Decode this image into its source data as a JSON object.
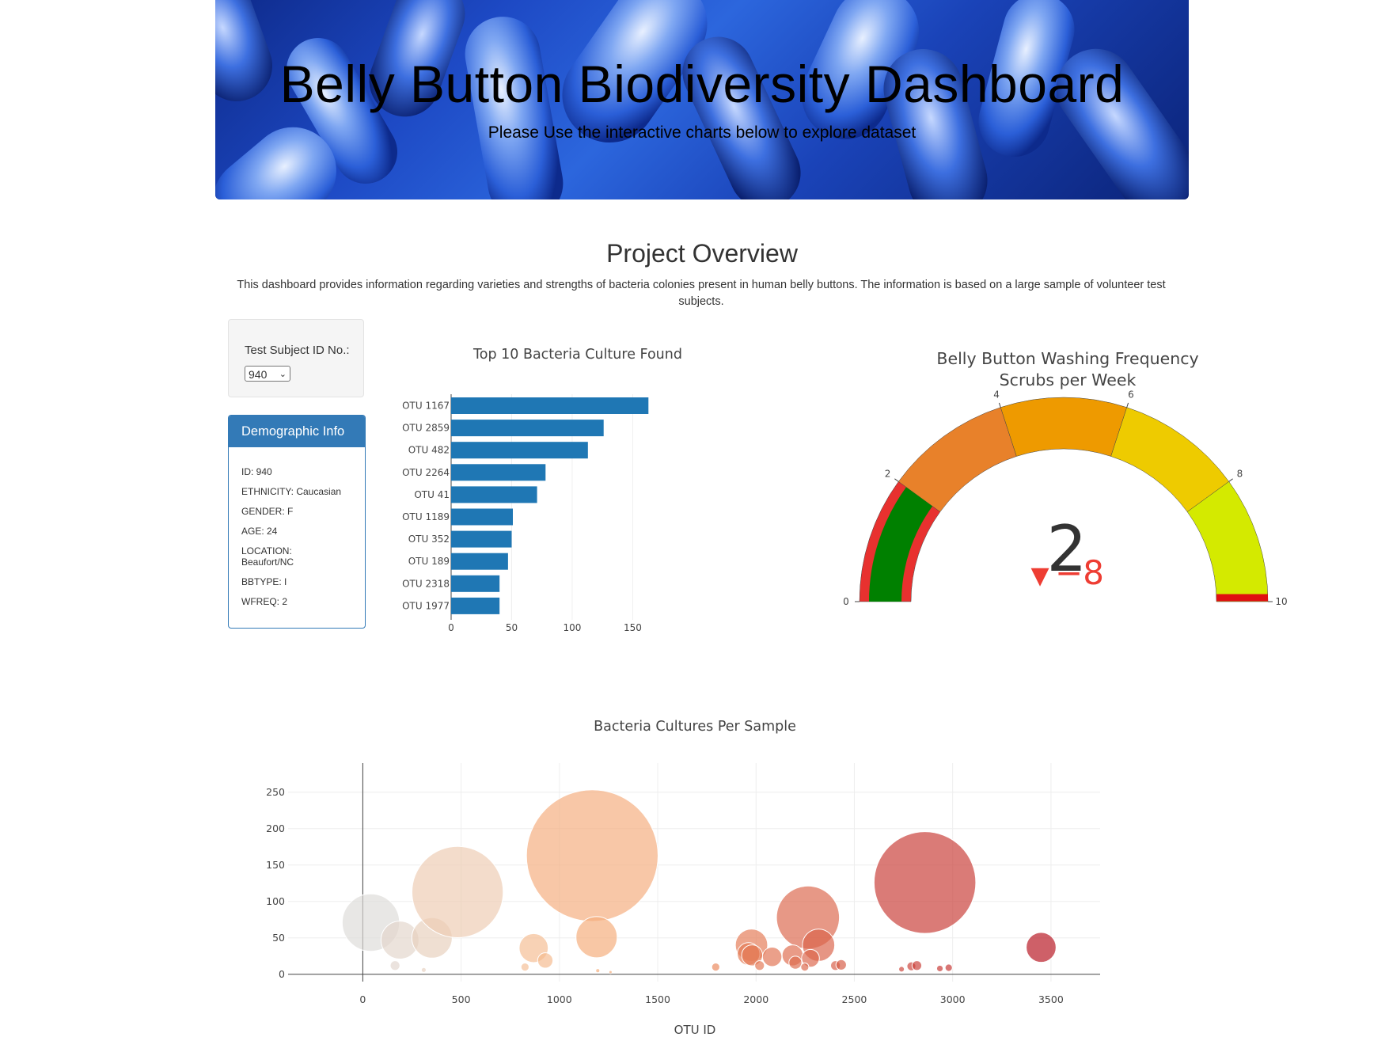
{
  "header": {
    "title": "Belly Button Biodiversity Dashboard",
    "subtitle": "Please Use the interactive charts below to explore dataset"
  },
  "overview": {
    "title": "Project Overview",
    "text": "This dashboard provides information regarding varieties and strengths of bacteria colonies present in human belly buttons. The information is based on a large sample of volunteer test subjects."
  },
  "selector": {
    "label": "Test Subject ID No.:",
    "value": "940"
  },
  "demographic": {
    "title": "Demographic Info",
    "items": [
      "ID: 940",
      "ETHNICITY: Caucasian",
      "GENDER: F",
      "AGE: 24",
      "LOCATION:\nBeaufort/NC",
      "BBTYPE: I",
      "WFREQ: 2"
    ]
  },
  "colors": {
    "bar": "#1f77b4",
    "panel": "#337ab7",
    "gauge_green": "#008000",
    "gauge_red": "#e8312f",
    "delta_red": "#ee3d33"
  },
  "chart_data": [
    {
      "type": "bar",
      "orientation": "horizontal",
      "title": "Top 10 Bacteria Culture Found",
      "categories": [
        "OTU 1167",
        "OTU 2859",
        "OTU 482",
        "OTU 2264",
        "OTU 41",
        "OTU 1189",
        "OTU 352",
        "OTU 189",
        "OTU 2318",
        "OTU 1977"
      ],
      "values": [
        163,
        126,
        113,
        78,
        71,
        51,
        50,
        47,
        40,
        40
      ],
      "xticks": [
        0,
        50,
        100,
        150
      ],
      "xlim": [
        0,
        170
      ]
    },
    {
      "type": "gauge",
      "title": "Belly Button Washing Frequency",
      "subtitle": "Scrubs per Week",
      "value": 2,
      "delta": "−8",
      "range": [
        0,
        10
      ],
      "ticks": [
        0,
        2,
        4,
        6,
        8,
        10
      ],
      "steps": [
        {
          "range": [
            0,
            2
          ],
          "color": "#e8312f"
        },
        {
          "range": [
            2,
            4
          ],
          "color": "#e8812a"
        },
        {
          "range": [
            4,
            6
          ],
          "color": "#ee9a00"
        },
        {
          "range": [
            6,
            8
          ],
          "color": "#eecb00"
        },
        {
          "range": [
            8,
            10
          ],
          "color": "#d4ea00"
        }
      ],
      "bar_color": "#008000",
      "threshold": 10,
      "threshold_color": "#e01010"
    },
    {
      "type": "scatter",
      "mode": "bubble",
      "title": "Bacteria Cultures Per Sample",
      "xlabel": "OTU ID",
      "ylabel": "",
      "xlim": [
        -380,
        3750
      ],
      "ylim": [
        -10,
        290
      ],
      "xticks": [
        0,
        500,
        1000,
        1500,
        2000,
        2500,
        3000,
        3500
      ],
      "yticks": [
        0,
        50,
        100,
        150,
        200,
        250
      ],
      "grid": true,
      "points": [
        {
          "x": 41,
          "y": 71
        },
        {
          "x": 189,
          "y": 47
        },
        {
          "x": 352,
          "y": 50
        },
        {
          "x": 482,
          "y": 113
        },
        {
          "x": 164,
          "y": 12
        },
        {
          "x": 310,
          "y": 6
        },
        {
          "x": 1167,
          "y": 163
        },
        {
          "x": 1189,
          "y": 51
        },
        {
          "x": 869,
          "y": 36
        },
        {
          "x": 928,
          "y": 19
        },
        {
          "x": 825,
          "y": 10
        },
        {
          "x": 1195,
          "y": 5
        },
        {
          "x": 1260,
          "y": 3
        },
        {
          "x": 1795,
          "y": 10
        },
        {
          "x": 1977,
          "y": 40
        },
        {
          "x": 1962,
          "y": 28
        },
        {
          "x": 1980,
          "y": 26
        },
        {
          "x": 2082,
          "y": 24
        },
        {
          "x": 2018,
          "y": 12
        },
        {
          "x": 2264,
          "y": 78
        },
        {
          "x": 2186,
          "y": 26
        },
        {
          "x": 2318,
          "y": 40
        },
        {
          "x": 2277,
          "y": 22
        },
        {
          "x": 2200,
          "y": 16
        },
        {
          "x": 2248,
          "y": 10
        },
        {
          "x": 2404,
          "y": 12
        },
        {
          "x": 2433,
          "y": 13
        },
        {
          "x": 2859,
          "y": 126
        },
        {
          "x": 2740,
          "y": 7
        },
        {
          "x": 2790,
          "y": 11
        },
        {
          "x": 2818,
          "y": 12
        },
        {
          "x": 2935,
          "y": 8
        },
        {
          "x": 2980,
          "y": 9
        },
        {
          "x": 3450,
          "y": 37
        }
      ]
    }
  ]
}
